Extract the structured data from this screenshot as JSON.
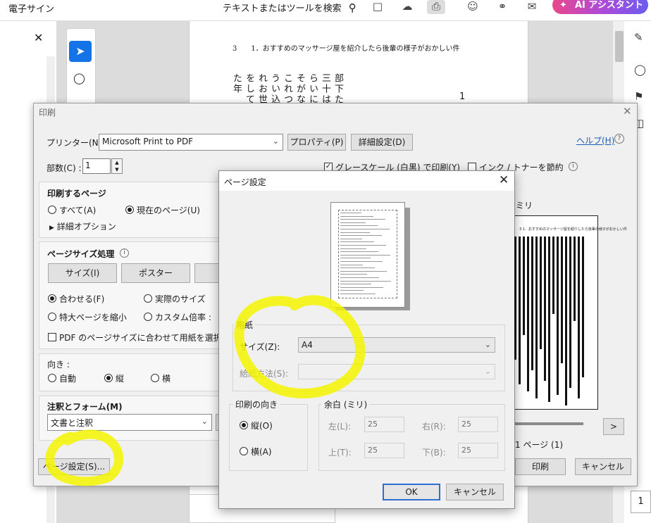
{
  "app": {
    "title": "電子サイン",
    "search_placeholder": "テキストまたはツールを検索",
    "ai_label": "AI アシスタント",
    "page_number": "1"
  },
  "document": {
    "header_text": "3　　1．おすすめのマッサージ屋を紹介したら後輩の様子がおかしい件",
    "vertical_text": "部下たち三十はたらいによそがなにこれつだうい込まれお世話をしてまた年",
    "page_number": "1"
  },
  "print_dialog": {
    "title": "印刷",
    "printer_label": "プリンター(N) :",
    "printer_value": "Microsoft Print to PDF",
    "properties_button": "プロパティ(P)",
    "advanced_button": "詳細設定(D)",
    "help_link": "ヘルプ(H)",
    "copies_label": "部数(C) :",
    "copies_value": "1",
    "grayscale_label": "グレースケール (白黒) で印刷(Y)",
    "grayscale_checked": true,
    "save_ink_label": "インク / トナーを節約",
    "save_ink_checked": false,
    "pages_section": {
      "title": "印刷するページ",
      "all_label": "すべて(A)",
      "current_label": "現在のページ(U)",
      "selected": "current",
      "more_options": "詳細オプション"
    },
    "sizing_section": {
      "title": "ページサイズ処理",
      "size_button": "サイズ(I)",
      "poster_button": "ポスター",
      "fit_label": "合わせる(F)",
      "actual_label": "実際のサイズ",
      "shrink_label": "特大ページを縮小",
      "custom_label": "カスタム倍率 :",
      "selected": "fit",
      "pdf_paper_label": "PDF のページサイズに合わせて用紙を選択(Z)",
      "pdf_paper_checked": false
    },
    "orientation_section": {
      "title": "向き :",
      "auto_label": "自動",
      "portrait_label": "縦",
      "landscape_label": "横",
      "selected": "portrait"
    },
    "comments_section": {
      "title": "注釈とフォーム(M)",
      "value": "文書と注釈"
    },
    "page_setup_button": "ページ設定(S)...",
    "preview": {
      "units_label": "ミリ",
      "page_info": "1 ページ (1)",
      "next_button": ">",
      "header_text": "3 1．おすすめのマッサージ屋を紹介したら後輩の様子がおかしい件"
    },
    "print_button": "印刷",
    "cancel_button": "キャンセル"
  },
  "page_setup_dialog": {
    "title": "ページ設定",
    "paper_group_title": "用紙",
    "size_label": "サイズ(Z):",
    "size_value": "A4",
    "source_label": "給紙方法(S):",
    "source_value": "",
    "orientation_group_title": "印刷の向き",
    "portrait_label": "縦(O)",
    "landscape_label": "横(A)",
    "orientation_selected": "portrait",
    "margins_group_title": "余白 (ミリ)",
    "margin_left_label": "左(L):",
    "margin_left_value": "25",
    "margin_right_label": "右(R):",
    "margin_right_value": "25",
    "margin_top_label": "上(T):",
    "margin_top_value": "25",
    "margin_bottom_label": "下(B):",
    "margin_bottom_value": "25",
    "ok_button": "OK",
    "cancel_button": "キャンセル"
  },
  "colors": {
    "accent": "#1473e6",
    "highlight": "#f5f500",
    "ai_gradient_start": "#e9478b",
    "ai_gradient_end": "#6b5cf0"
  }
}
